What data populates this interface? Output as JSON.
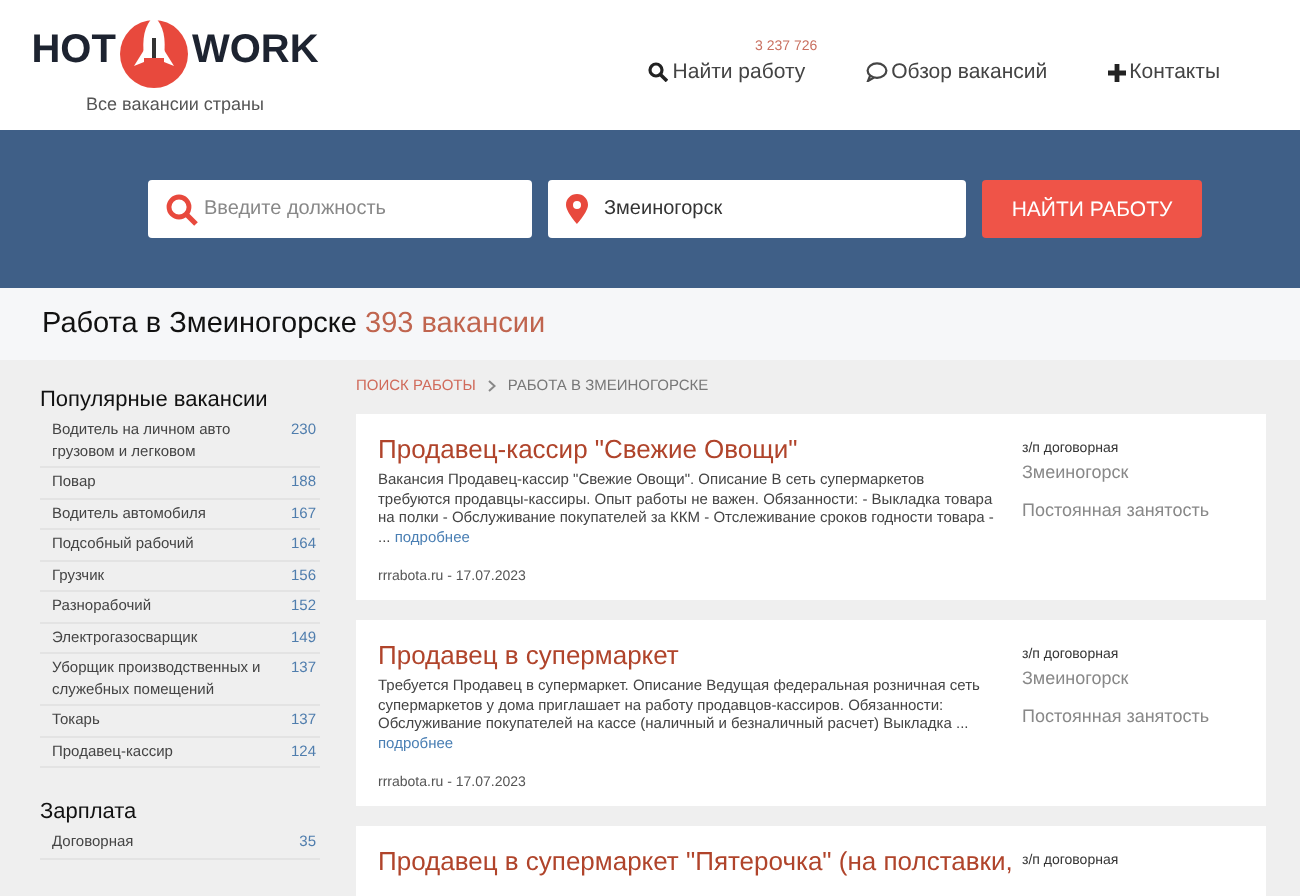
{
  "header": {
    "logo_left": "HOT",
    "logo_right": "WORK",
    "tagline": "Все вакансии страны",
    "nav": [
      {
        "kind": "search",
        "label": "Найти работу",
        "badge": "3 237 726"
      },
      {
        "kind": "chat",
        "label": "Обзор вакансий"
      },
      {
        "kind": "plus",
        "label": "Контакты"
      }
    ]
  },
  "search": {
    "position_placeholder": "Введите должность",
    "city_value": "Змеиногорск",
    "button": "НАЙТИ РАБОТУ"
  },
  "page_title": {
    "text": "Работа в Змеиногорске",
    "count": "393 вакансии"
  },
  "sidebar": {
    "sections": [
      {
        "title": "Популярные вакансии",
        "items": [
          {
            "label": "Водитель на личном авто грузовом и легковом",
            "count": "230"
          },
          {
            "label": "Повар",
            "count": "188"
          },
          {
            "label": "Водитель автомобиля",
            "count": "167"
          },
          {
            "label": "Подсобный рабочий",
            "count": "164"
          },
          {
            "label": "Грузчик",
            "count": "156"
          },
          {
            "label": "Разнорабочий",
            "count": "152"
          },
          {
            "label": "Электрогазосварщик",
            "count": "149"
          },
          {
            "label": "Уборщик производственных и служебных помещений",
            "count": "137"
          },
          {
            "label": "Токарь",
            "count": "137"
          },
          {
            "label": "Продавец-кассир",
            "count": "124"
          }
        ]
      },
      {
        "title": "Зарплата",
        "items": [
          {
            "label": "Договорная",
            "count": "35"
          }
        ]
      }
    ]
  },
  "breadcrumbs": [
    {
      "label": "ПОИСК РАБОТЫ",
      "link": true
    },
    {
      "label": "РАБОТА В ЗМЕИНОГОРСКЕ",
      "link": false
    }
  ],
  "jobs": [
    {
      "title": "Продавец-кассир \"Свежие Овощи\"",
      "description": "Вакансия Продавец-кассир \"Свежие Овощи\". Описание В сеть супермаркетов требуются продавцы-кассиры. Опыт работы не важен. Обязанности: - Выкладка товара на полки - Обслуживание покупателей за ККМ - Отслеживание сроков годности товара - ...",
      "more": "подробнее",
      "source": "rrrabota.ru - 17.07.2023",
      "salary": "з/п договорная",
      "city": "Змеиногорск",
      "employment": "Постоянная занятость"
    },
    {
      "title": "Продавец в супермаркет",
      "description": "Требуется Продавец в супермаркет. Описание Ведущая федеральная розничная сеть супермаркетов у дома приглашает на работу продавцов-кассиров. Обязанности: Обслуживание покупателей на кассе (наличный и безналичный расчет) Выкладка ...",
      "more": "подробнее",
      "source": "rrrabota.ru - 17.07.2023",
      "salary": "з/п договорная",
      "city": "Змеиногорск",
      "employment": "Постоянная занятость"
    },
    {
      "title": "Продавец в супермаркет \"Пятерочка\" (на полставки,",
      "salary": "з/п договорная"
    }
  ]
}
